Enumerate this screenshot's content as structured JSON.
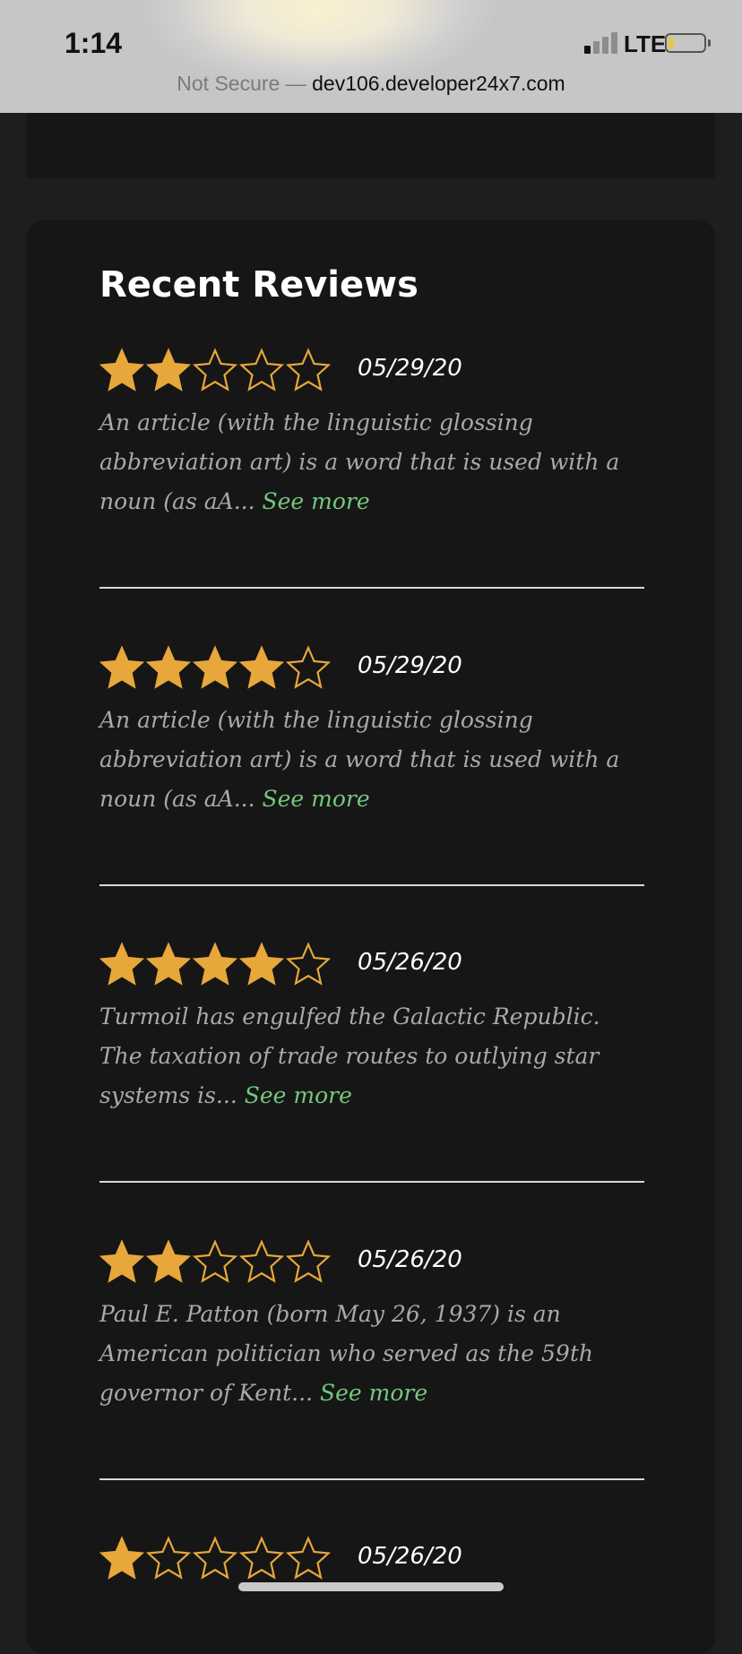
{
  "status_bar": {
    "time": "1:14",
    "network": "LTE",
    "signal_bars_filled": 1,
    "signal_bars_total": 4,
    "battery_level": 0.1
  },
  "url_bar": {
    "security": "Not Secure",
    "separator": "—",
    "host": "dev106.developer24x7.com"
  },
  "section": {
    "title": "Recent Reviews"
  },
  "colors": {
    "star": "#e7a73a",
    "see_more": "#74c77e",
    "card": "#161616",
    "page": "#1e1e1e"
  },
  "reviews": [
    {
      "rating": 2,
      "date": "05/29/20",
      "excerpt": "An article (with the linguistic glossing abbreviation art) is a word that is used with a noun (as aA...",
      "link": "See more"
    },
    {
      "rating": 4,
      "date": "05/29/20",
      "excerpt": "An article (with the linguistic glossing abbreviation art) is a word that is used with a noun (as aA...",
      "link": "See more"
    },
    {
      "rating": 4,
      "date": "05/26/20",
      "excerpt": "Turmoil has engulfed the Galactic Republic. The taxation of trade routes to outlying star systems is...",
      "link": "See more"
    },
    {
      "rating": 2,
      "date": "05/26/20",
      "excerpt": "Paul E. Patton (born May 26, 1937) is an American politician who served as the 59th governor of Kent...",
      "link": "See more"
    },
    {
      "rating": 1,
      "date": "05/26/20",
      "excerpt": "",
      "link": ""
    }
  ]
}
